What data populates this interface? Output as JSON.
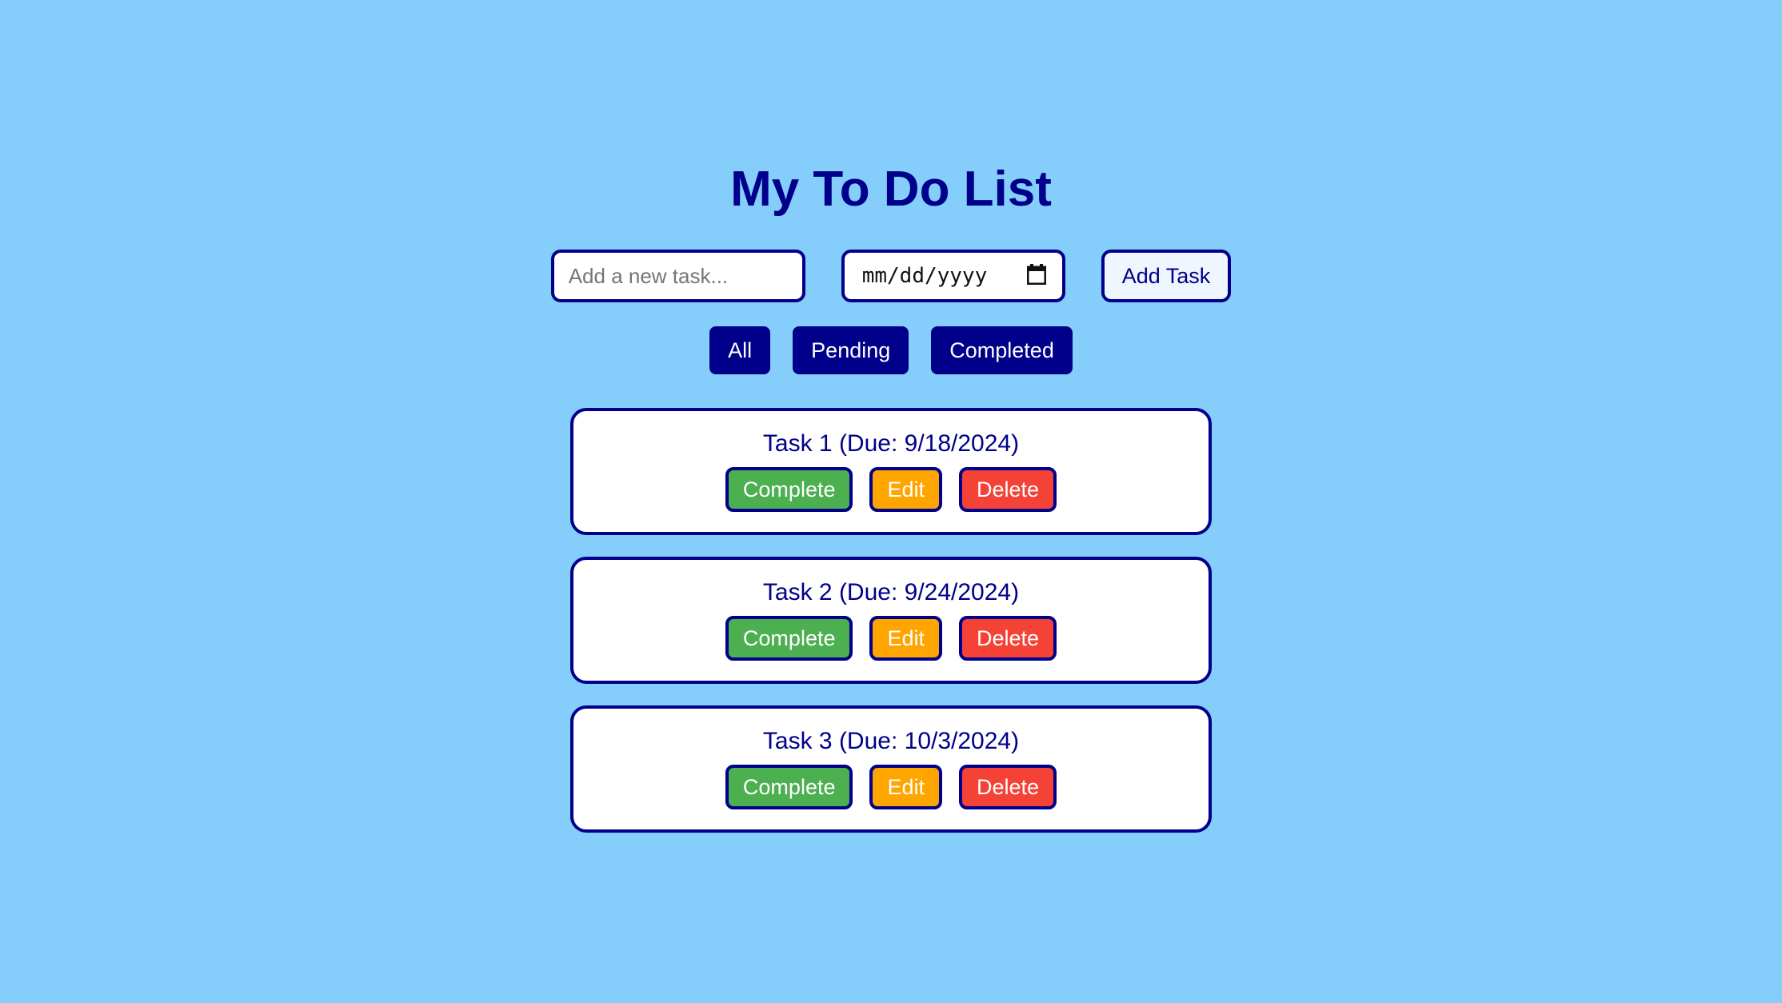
{
  "theme": {
    "background": "#85cdfa",
    "primary": "#00008b",
    "card_background": "#ffffff",
    "complete_color": "#4caf50",
    "edit_color": "#ffa500",
    "delete_color": "#f44336",
    "add_task_background": "#eff6ff",
    "placeholder_color": "#757575"
  },
  "header": {
    "title": "My To Do List"
  },
  "add_form": {
    "task_input": {
      "value": "",
      "placeholder": "Add a new task..."
    },
    "date_input": {
      "value": "",
      "placeholder": "mm/dd/yyyy",
      "icon": "calendar-icon"
    },
    "add_button_label": "Add Task"
  },
  "filters": {
    "items": [
      {
        "label": "All"
      },
      {
        "label": "Pending"
      },
      {
        "label": "Completed"
      }
    ]
  },
  "tasks": {
    "actions": {
      "complete_label": "Complete",
      "edit_label": "Edit",
      "delete_label": "Delete"
    },
    "items": [
      {
        "title": "Task 1 (Due: 9/18/2024)",
        "name": "Task 1",
        "due": "9/18/2024"
      },
      {
        "title": "Task 2 (Due: 9/24/2024)",
        "name": "Task 2",
        "due": "9/24/2024"
      },
      {
        "title": "Task 3 (Due: 10/3/2024)",
        "name": "Task 3",
        "due": "10/3/2024"
      }
    ]
  }
}
